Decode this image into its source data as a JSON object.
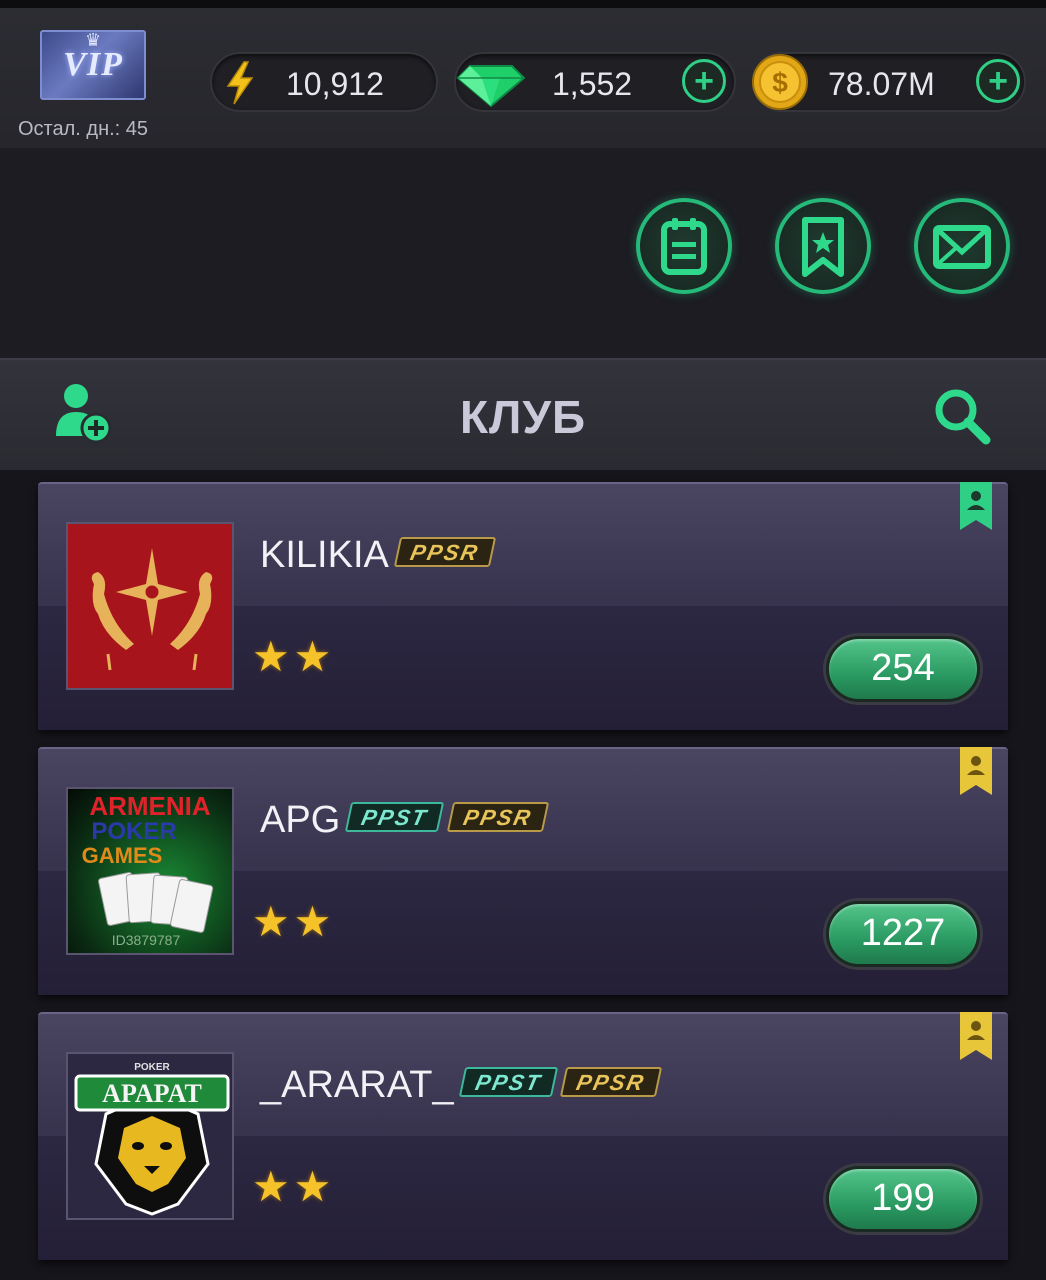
{
  "top": {
    "vip_label": "VIP",
    "days_left": "Остал. дн.: 45",
    "energy": "10,912",
    "gems": "1,552",
    "coins": "78.07M"
  },
  "header": {
    "title": "КЛУБ"
  },
  "clubs": [
    {
      "name": "KILIKIA",
      "tags": [
        "PPSR"
      ],
      "stars": "★★",
      "count": "254",
      "bookmark_color": "#2fcf86"
    },
    {
      "name": "APG",
      "tags": [
        "PPST",
        "PPSR"
      ],
      "stars": "★★",
      "count": "1227",
      "bookmark_color": "#e8c63a",
      "logo_text": [
        "ARMENIA",
        "POKER",
        "GAMES",
        "ID3879787"
      ]
    },
    {
      "name": "_ARARAT_",
      "tags": [
        "PPST",
        "PPSR"
      ],
      "stars": "★★",
      "count": "199",
      "bookmark_color": "#e8c63a",
      "logo_text": [
        "POKER",
        "APAPAT"
      ]
    }
  ]
}
